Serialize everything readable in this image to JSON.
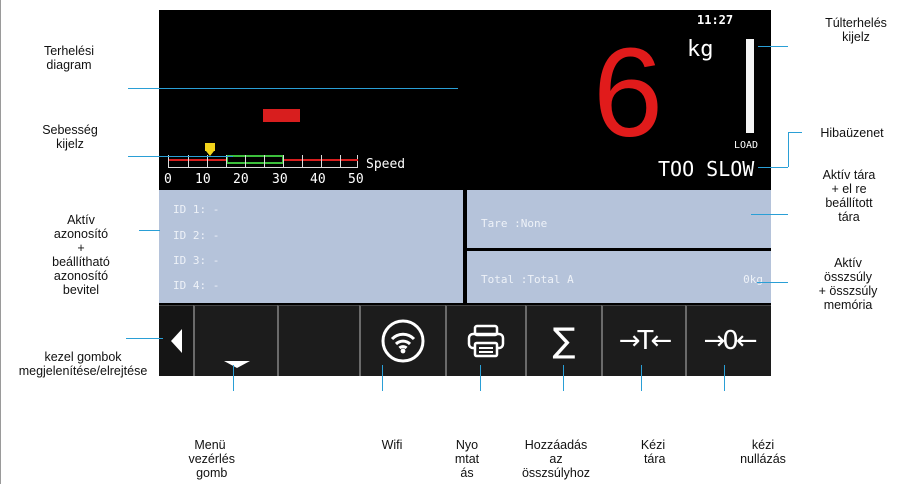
{
  "screen": {
    "time": "11:27",
    "weight_value": "6",
    "unit": "kg",
    "load_label": "LOAD",
    "error_message": "TOO SLOW",
    "speed_label": "Speed",
    "speed_ticks": [
      "0",
      "10",
      "20",
      "30",
      "40",
      "50"
    ],
    "ids": [
      "ID 1: -",
      "ID 2: -",
      "ID 3: -",
      "ID 4: -"
    ],
    "tare_text": "Tare  :None",
    "total_text": "Total :Total A",
    "total_value": "0kg",
    "colors": {
      "weight": "#e11b1b",
      "panel": "#b5c3da",
      "speed_ok": "#3cbf3c",
      "speed_bad": "#d81e1e"
    }
  },
  "buttons": [
    {
      "icon": "menu-down-icon"
    },
    {
      "icon": "blank"
    },
    {
      "icon": "wifi-icon"
    },
    {
      "icon": "printer-icon",
      "glyph": "🖶"
    },
    {
      "icon": "sigma-icon",
      "glyph": "∑"
    },
    {
      "icon": "manual-tare-icon",
      "glyph": "→T←"
    },
    {
      "icon": "manual-zero-icon",
      "glyph": "→0←"
    }
  ],
  "annotations": {
    "load_diagram": "Terhelési\ndiagram",
    "speed_display": "Sebesség\nkijelz",
    "active_id": "Aktív\nazonosító\n+\nbeállítható\nazonosító\nbevitel",
    "show_hide": "kezel  gombok\nmegjelenítése/elrejtése",
    "overload": "Túlterhelés\nkijelz",
    "error": "Hibaüzenet",
    "tare": "Aktív tára\n+ el  re\nbeállított\ntára",
    "total": "Aktív\nösszsúly\n+ összsúly\nmemória",
    "menu": "Menü\nvezérlés\ngomb",
    "wifi": "Wifi",
    "print": "Nyo\nmtat\nás",
    "add_total": "Hozzáadás\naz\nösszsúlyhoz",
    "manual_tare": "Kézi\ntára",
    "manual_zero": "kézi\nnullázás"
  }
}
